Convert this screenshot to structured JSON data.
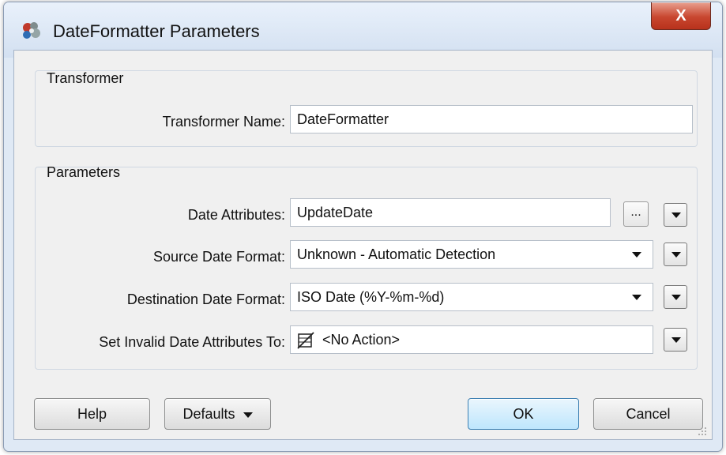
{
  "window": {
    "title": "DateFormatter Parameters",
    "close_label": "X"
  },
  "transformer_group": {
    "label": "Transformer",
    "name_label": "Transformer Name:",
    "name_value": "DateFormatter"
  },
  "parameters_group": {
    "label": "Parameters",
    "date_attributes_label": "Date Attributes:",
    "date_attributes_value": "UpdateDate",
    "ellipsis_label": "...",
    "source_format_label": "Source Date Format:",
    "source_format_value": "Unknown - Automatic Detection",
    "dest_format_label": "Destination Date Format:",
    "dest_format_value": "ISO Date (%Y-%m-%d)",
    "invalid_label": "Set Invalid Date Attributes To:",
    "invalid_value": "<No Action>"
  },
  "buttons": {
    "help": "Help",
    "defaults": "Defaults",
    "ok": "OK",
    "cancel": "Cancel"
  },
  "icons": {
    "app": "fme-transformer-icon",
    "null_value": "null-value-icon",
    "dropdown": "chevron-down-icon"
  }
}
